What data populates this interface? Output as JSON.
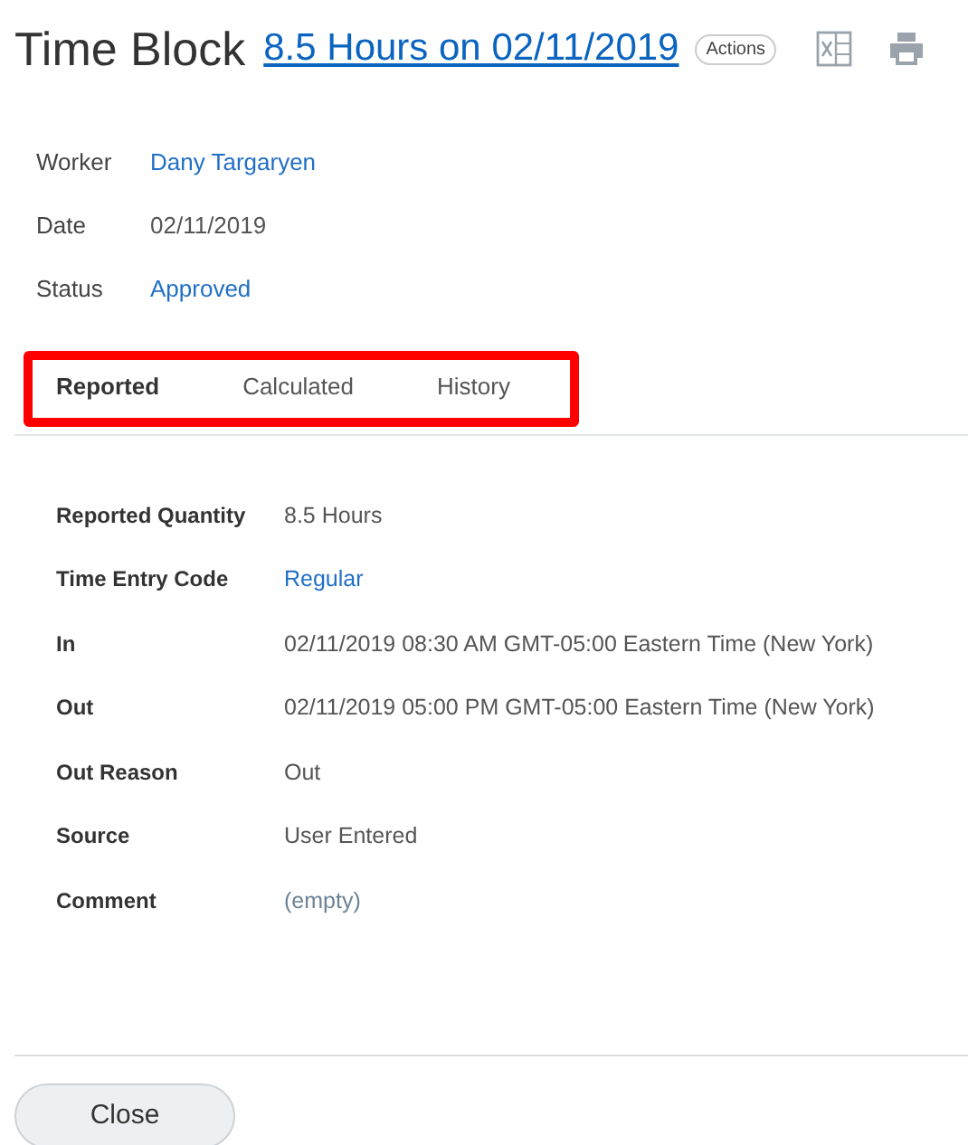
{
  "header": {
    "title": "Time Block",
    "subtitle_link": "8.5 Hours on 02/11/2019",
    "actions_label": "Actions"
  },
  "summary": [
    {
      "label": "Worker",
      "value": "Dany Targaryen",
      "kind": "link"
    },
    {
      "label": "Date",
      "value": "02/11/2019",
      "kind": "plain"
    },
    {
      "label": "Status",
      "value": "Approved",
      "kind": "link"
    }
  ],
  "tabs_highlighted": true,
  "tabs": [
    {
      "label": "Reported",
      "selected": true
    },
    {
      "label": "Calculated",
      "selected": false
    },
    {
      "label": "History",
      "selected": false
    }
  ],
  "details": [
    {
      "label": "Reported Quantity",
      "value": "8.5 Hours",
      "kind": "plain"
    },
    {
      "label": "Time Entry Code",
      "value": "Regular",
      "kind": "link"
    },
    {
      "label": "In",
      "value": "02/11/2019 08:30 AM GMT-05:00 Eastern Time (New York)",
      "kind": "plain"
    },
    {
      "label": "Out",
      "value": "02/11/2019 05:00 PM GMT-05:00 Eastern Time (New York)",
      "kind": "plain"
    },
    {
      "label": "Out Reason",
      "value": "Out",
      "kind": "plain"
    },
    {
      "label": "Source",
      "value": "User Entered",
      "kind": "plain"
    },
    {
      "label": "Comment",
      "value": "(empty)",
      "kind": "empty"
    }
  ],
  "buttons": [
    "Close"
  ]
}
